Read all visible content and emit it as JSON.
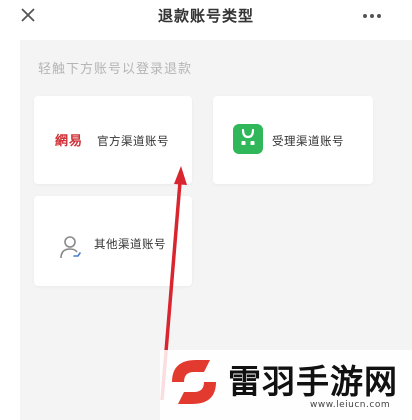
{
  "header": {
    "title": "退款账号类型",
    "close_icon": "close-icon",
    "more_icon": "more-dots-icon"
  },
  "hint": "轻触下方账号以登录退款",
  "cards": {
    "official": {
      "logo_text": "網易",
      "label": "官方渠道账号"
    },
    "accept": {
      "icon": "green-bag-icon",
      "label": "受理渠道账号"
    },
    "other": {
      "icon": "user-icon",
      "label": "其他渠道账号"
    }
  },
  "watermark": {
    "brand": "雷羽手游网",
    "url": "www.leiucn.com",
    "logo_icon": "leiyu-logo-icon"
  },
  "colors": {
    "background": "#f4f4f4",
    "accent_green": "#2fb75a",
    "netease_red": "#d0323a",
    "arrow_red": "#d9252f"
  }
}
